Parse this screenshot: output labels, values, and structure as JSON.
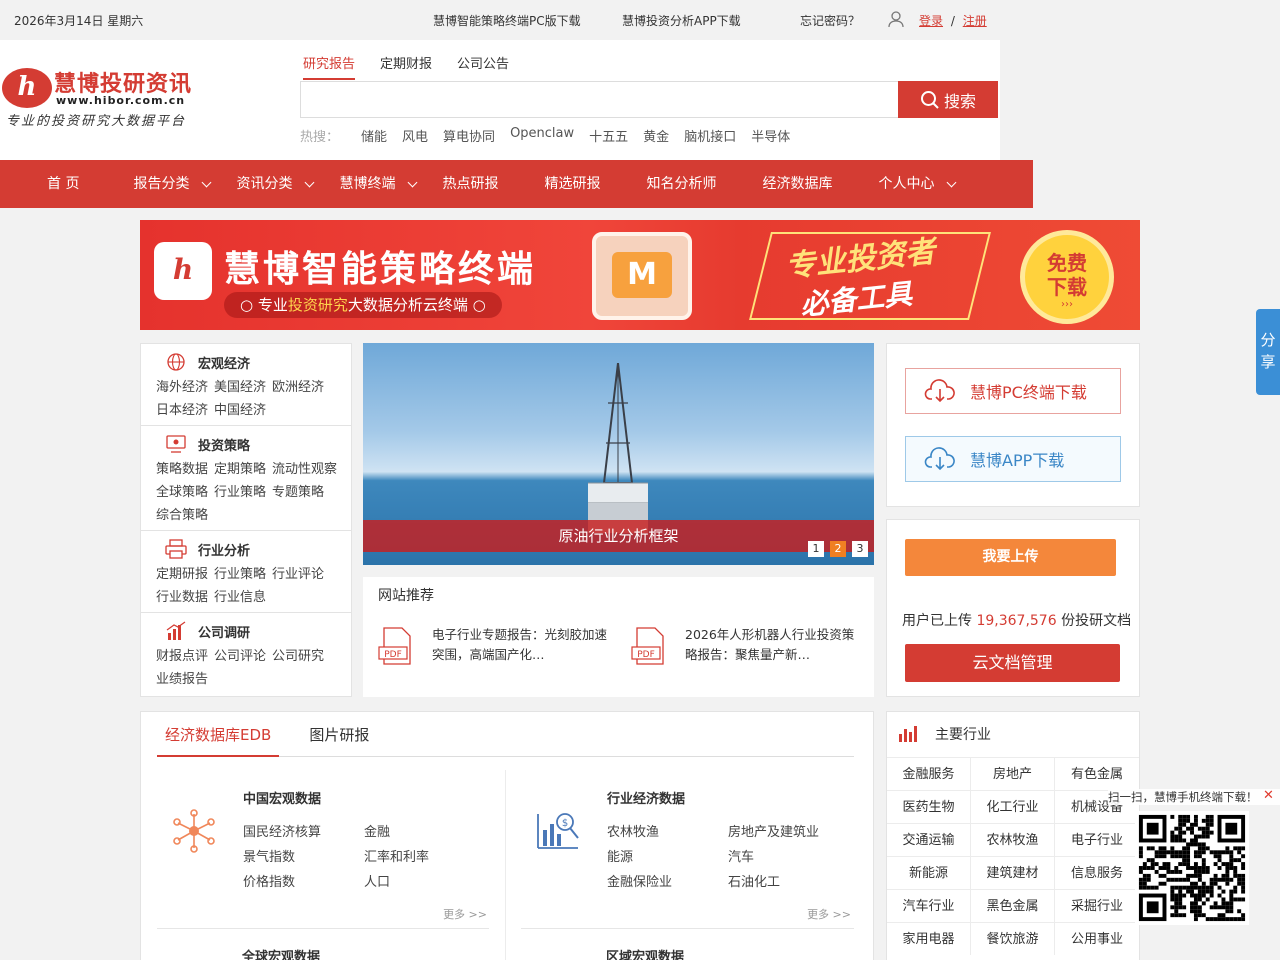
{
  "topbar": {
    "date": "2026年3月14日 星期六",
    "pc_download": "慧博智能策略终端PC版下载",
    "app_download": "慧博投资分析APP下载",
    "forgot": "忘记密码？",
    "login": "登录",
    "sep": "/",
    "register": "注册"
  },
  "logo": {
    "badge": "h",
    "name": "慧博投研资讯",
    "url": "www.hibor.com.cn",
    "slogan": "专业的投资研究大数据平台"
  },
  "search": {
    "tabs": [
      "研究报告",
      "定期财报",
      "公司公告"
    ],
    "placeholder": "",
    "button": "搜索",
    "hot_label": "热搜：",
    "hot": [
      "储能",
      "风电",
      "算电协同",
      "Openclaw",
      "十五五",
      "黄金",
      "脑机接口",
      "半导体"
    ]
  },
  "nav": [
    {
      "label": "首 页",
      "dropdown": false
    },
    {
      "label": "报告分类",
      "dropdown": true
    },
    {
      "label": "资讯分类",
      "dropdown": true
    },
    {
      "label": "慧博终端",
      "dropdown": true
    },
    {
      "label": "热点研报",
      "dropdown": false
    },
    {
      "label": "精选研报",
      "dropdown": false
    },
    {
      "label": "知名分析师",
      "dropdown": false
    },
    {
      "label": "经济数据库",
      "dropdown": false
    },
    {
      "label": "个人中心",
      "dropdown": true
    }
  ],
  "banner": {
    "title": "慧博智能策略终端",
    "sub_pre": "专业",
    "sub_hl": "投资研究",
    "sub_post": "大数据分析云终端",
    "slogan1": "专业投资者",
    "slogan2": "必备工具",
    "cta1": "免费",
    "cta2": "下载",
    "cta_arrow": "›››"
  },
  "categories": [
    {
      "title": "宏观经济",
      "icon": "globe-icon",
      "links": [
        "海外经济",
        "美国经济",
        "欧洲经济",
        "日本经济",
        "中国经济"
      ]
    },
    {
      "title": "投资策略",
      "icon": "monitor-icon",
      "links": [
        "策略数据",
        "定期策略",
        "流动性观察",
        "全球策略",
        "行业策略",
        "专题策略",
        "综合策略"
      ]
    },
    {
      "title": "行业分析",
      "icon": "printer-icon",
      "links": [
        "定期研报",
        "行业策略",
        "行业评论",
        "行业数据",
        "行业信息"
      ]
    },
    {
      "title": "公司调研",
      "icon": "bar-chart-icon",
      "links": [
        "财报点评",
        "公司评论",
        "公司研究",
        "业绩报告"
      ]
    }
  ],
  "slider": {
    "caption": "原油行业分析框架",
    "pages": [
      "1",
      "2",
      "3"
    ],
    "active": 1
  },
  "recommend": {
    "title": "网站推荐",
    "items": [
      {
        "text": "电子行业专题报告：光刻胶加速突围，高端国产化…"
      },
      {
        "text": "2026年人形机器人行业投资策略报告：聚焦量产新…"
      }
    ],
    "pdf_label": "PDF"
  },
  "downloads": {
    "pc": "慧博PC终端下载",
    "app": "慧博APP下载"
  },
  "upload": {
    "button": "我要上传",
    "pre": "用户已上传 ",
    "count": "19,367,576",
    "post": " 份投研文档",
    "cloud": "云文档管理"
  },
  "edb": {
    "tabs": [
      "经济数据库EDB",
      "图片研报"
    ],
    "groups": [
      {
        "title": "中国宏观数据",
        "icon": "network-icon",
        "links": [
          "国民经济核算",
          "金融",
          "景气指数",
          "汇率和利率",
          "价格指数",
          "人口"
        ],
        "more": "更多 >>"
      },
      {
        "title": "行业经济数据",
        "icon": "money-chart-icon",
        "links": [
          "农林牧渔",
          "房地产及建筑业",
          "能源",
          "汽车",
          "金融保险业",
          "石油化工"
        ],
        "more": "更多 >>"
      },
      {
        "title": "全球宏观数据",
        "links": []
      },
      {
        "title": "区域宏观数据",
        "links": []
      }
    ]
  },
  "industry": {
    "title": "主要行业",
    "items": [
      "金融服务",
      "房地产",
      "有色金属",
      "医药生物",
      "化工行业",
      "机械设备",
      "交通运输",
      "农林牧渔",
      "电子行业",
      "新能源",
      "建筑建材",
      "信息服务",
      "汽车行业",
      "黑色金属",
      "采掘行业",
      "家用电器",
      "餐饮旅游",
      "公用事业"
    ]
  },
  "share": {
    "label": "分享"
  },
  "qr": {
    "label": "扫一扫，慧博手机终端下载！",
    "close": "✕"
  },
  "colors": {
    "brand": "#d43c33",
    "orange": "#f4873b",
    "blue": "#3b8fd6"
  }
}
